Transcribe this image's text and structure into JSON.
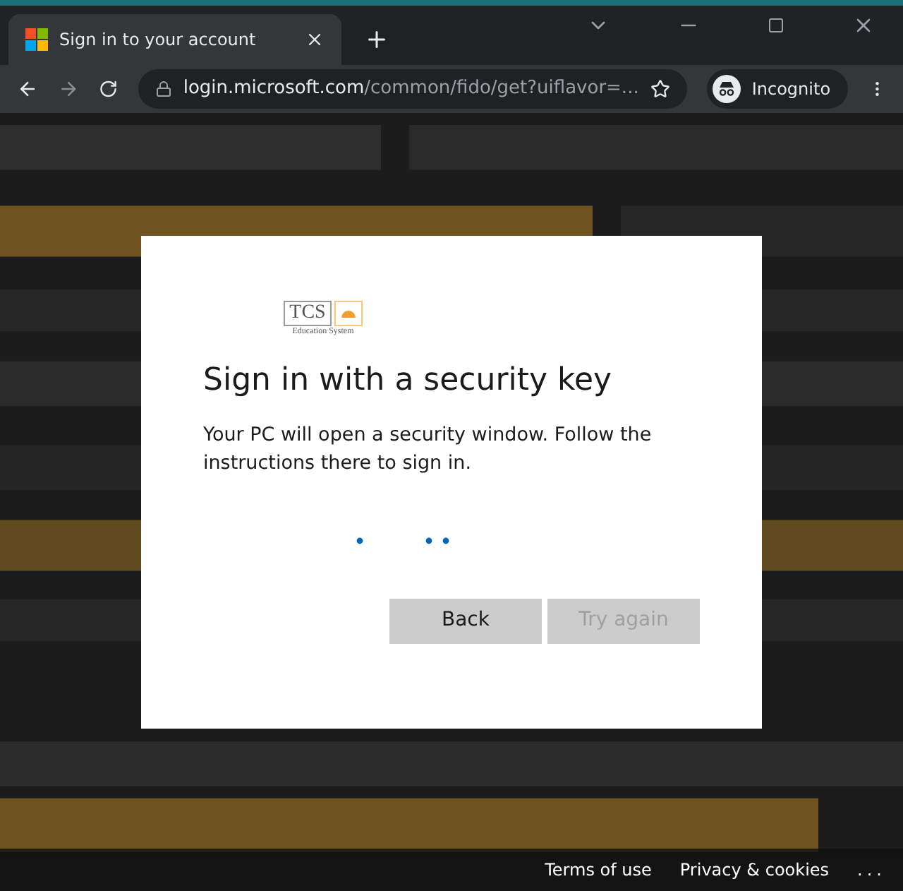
{
  "browser": {
    "tab": {
      "title": "Sign in to your account"
    },
    "address": {
      "host": "login.microsoft.com",
      "path": "/common/fido/get?uiflavor=..."
    },
    "profile": "Incognito"
  },
  "dialog": {
    "logo": {
      "name": "TCS",
      "caption": "Education System"
    },
    "title": "Sign in with a security key",
    "message": "Your PC will open a security window. Follow the instructions there to sign in.",
    "buttons": [
      {
        "label": "Back",
        "disabled": false
      },
      {
        "label": "Try again",
        "disabled": true
      }
    ]
  },
  "footer": {
    "links": [
      "Terms of use",
      "Privacy & cookies"
    ],
    "more": "..."
  }
}
